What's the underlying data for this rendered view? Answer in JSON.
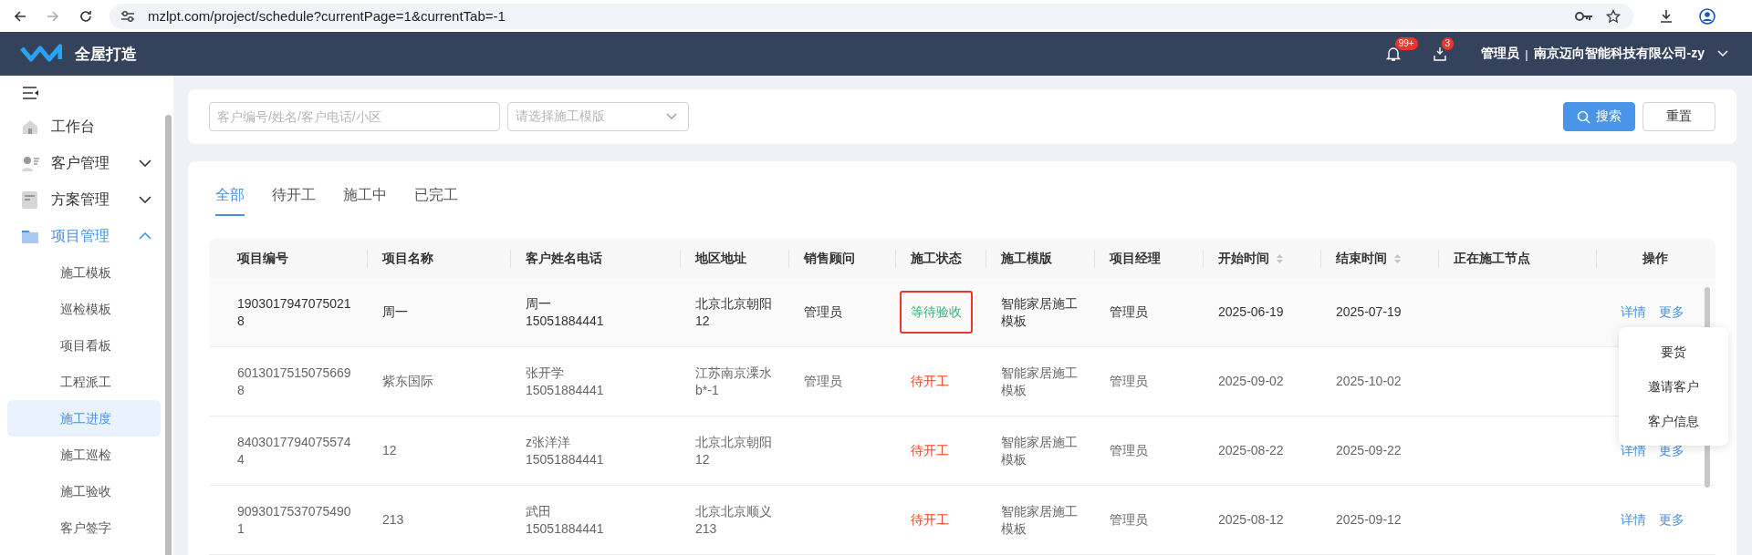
{
  "browser": {
    "url": "mzlpt.com/project/schedule?currentPage=1&currentTab=-1"
  },
  "header": {
    "app_name": "全屋打造",
    "notifications_badge": "99+",
    "messages_badge": "3",
    "user_role": "管理员",
    "separator": "|",
    "company": "南京迈向智能科技有限公司-zy"
  },
  "sidebar": {
    "items": [
      {
        "label": "工作台",
        "expandable": false,
        "expanded": false,
        "selected": false
      },
      {
        "label": "客户管理",
        "expandable": true,
        "expanded": false,
        "selected": false
      },
      {
        "label": "方案管理",
        "expandable": true,
        "expanded": false,
        "selected": false
      },
      {
        "label": "项目管理",
        "expandable": true,
        "expanded": true,
        "selected": false,
        "children": [
          {
            "label": "施工模板",
            "selected": false
          },
          {
            "label": "巡检模板",
            "selected": false
          },
          {
            "label": "项目看板",
            "selected": false
          },
          {
            "label": "工程派工",
            "selected": false
          },
          {
            "label": "施工进度",
            "selected": true
          },
          {
            "label": "施工巡检",
            "selected": false
          },
          {
            "label": "施工验收",
            "selected": false
          },
          {
            "label": "客户签字",
            "selected": false
          }
        ]
      }
    ]
  },
  "filters": {
    "keyword": {
      "placeholder": "客户编号/姓名/客户电话/小区"
    },
    "template": {
      "placeholder": "请选择施工模版"
    },
    "search_button": "搜索",
    "reset_button": "重置"
  },
  "tabs": [
    {
      "label": "全部",
      "selected": true
    },
    {
      "label": "待开工",
      "selected": false
    },
    {
      "label": "施工中",
      "selected": false
    },
    {
      "label": "已完工",
      "selected": false
    }
  ],
  "table": {
    "columns": [
      {
        "label": "项目编号",
        "sortable": false
      },
      {
        "label": "项目名称",
        "sortable": false
      },
      {
        "label": "客户姓名电话",
        "sortable": false
      },
      {
        "label": "地区地址",
        "sortable": false
      },
      {
        "label": "销售顾问",
        "sortable": false
      },
      {
        "label": "施工状态",
        "sortable": false
      },
      {
        "label": "施工模版",
        "sortable": false
      },
      {
        "label": "项目经理",
        "sortable": false
      },
      {
        "label": "开始时间",
        "sortable": true
      },
      {
        "label": "结束时间",
        "sortable": true
      },
      {
        "label": "正在施工节点",
        "sortable": false
      },
      {
        "label": "操作",
        "sortable": false
      }
    ],
    "rows": [
      {
        "hovered": true,
        "id": "19030179470750218",
        "name": "周一",
        "customer_name": "周一",
        "customer_phone": "15051884441",
        "address": "北京北京朝阳12",
        "sales": "管理员",
        "status": {
          "text": "等待验收",
          "kind": "awaiting_acceptance",
          "outlined": true
        },
        "template": "智能家居施工模板",
        "manager": "管理员",
        "start": "2025-06-19",
        "end": "2025-07-19",
        "actions": [
          "详情",
          "更多"
        ]
      },
      {
        "hovered": false,
        "id": "60130175150756698",
        "name": "紫东国际",
        "customer_name": "张开学",
        "customer_phone": "15051884441",
        "address": "江苏南京溧水b*-1",
        "sales": "管理员",
        "status": {
          "text": "待开工",
          "kind": "not_started",
          "outlined": false
        },
        "template": "智能家居施工模板",
        "manager": "管理员",
        "start": "2025-09-02",
        "end": "2025-10-02"
      },
      {
        "hovered": false,
        "id": "84030177940755744",
        "name": "12",
        "customer_name": "z张洋洋",
        "customer_phone": "15051884441",
        "address": "北京北京朝阳12",
        "status": {
          "text": "待开工",
          "kind": "not_started",
          "outlined": false
        },
        "template": "智能家居施工模板",
        "manager": "管理员",
        "start": "2025-08-22",
        "end": "2025-09-22",
        "actions": [
          "详情",
          "更多"
        ]
      },
      {
        "hovered": false,
        "id": "90930175370754901",
        "name": "213",
        "customer_name": "武田",
        "customer_phone": "15051884441",
        "address": "北京北京顺义213",
        "status": {
          "text": "待开工",
          "kind": "not_started",
          "outlined": false
        },
        "template": "智能家居施工模板",
        "manager": "管理员",
        "start": "2025-08-12",
        "end": "2025-09-12",
        "actions": [
          "详情",
          "更多"
        ]
      }
    ]
  },
  "more_menu": {
    "items": [
      "要货",
      "邀请客户",
      "客户信息"
    ]
  }
}
